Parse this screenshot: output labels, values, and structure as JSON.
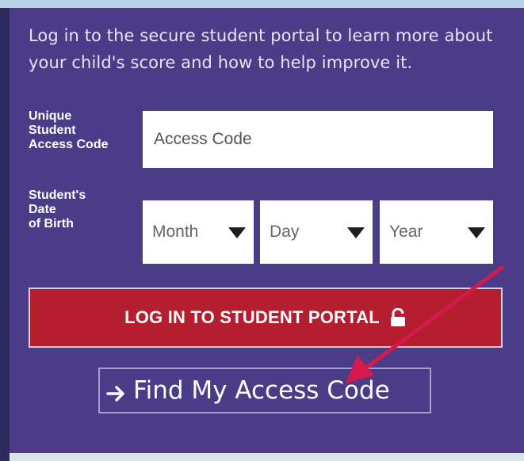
{
  "intro_text": "Log in to the secure student portal to learn more about your child's score and how to help improve it.",
  "access_code": {
    "label": "Unique\nStudent\nAccess Code",
    "placeholder": "Access Code"
  },
  "date_of_birth": {
    "label": "Student's\nDate\nof Birth",
    "month": "Month",
    "day": "Day",
    "year": "Year"
  },
  "login_button": {
    "label": "LOG IN TO STUDENT PORTAL",
    "icon": "lock-icon"
  },
  "find_code_link": {
    "label": "Find My Access Code",
    "icon": "arrow-right-icon"
  },
  "colors": {
    "panel": "#4a3c86",
    "login_button": "#b51e2f",
    "annotation_arrow": "#d41a4c"
  }
}
